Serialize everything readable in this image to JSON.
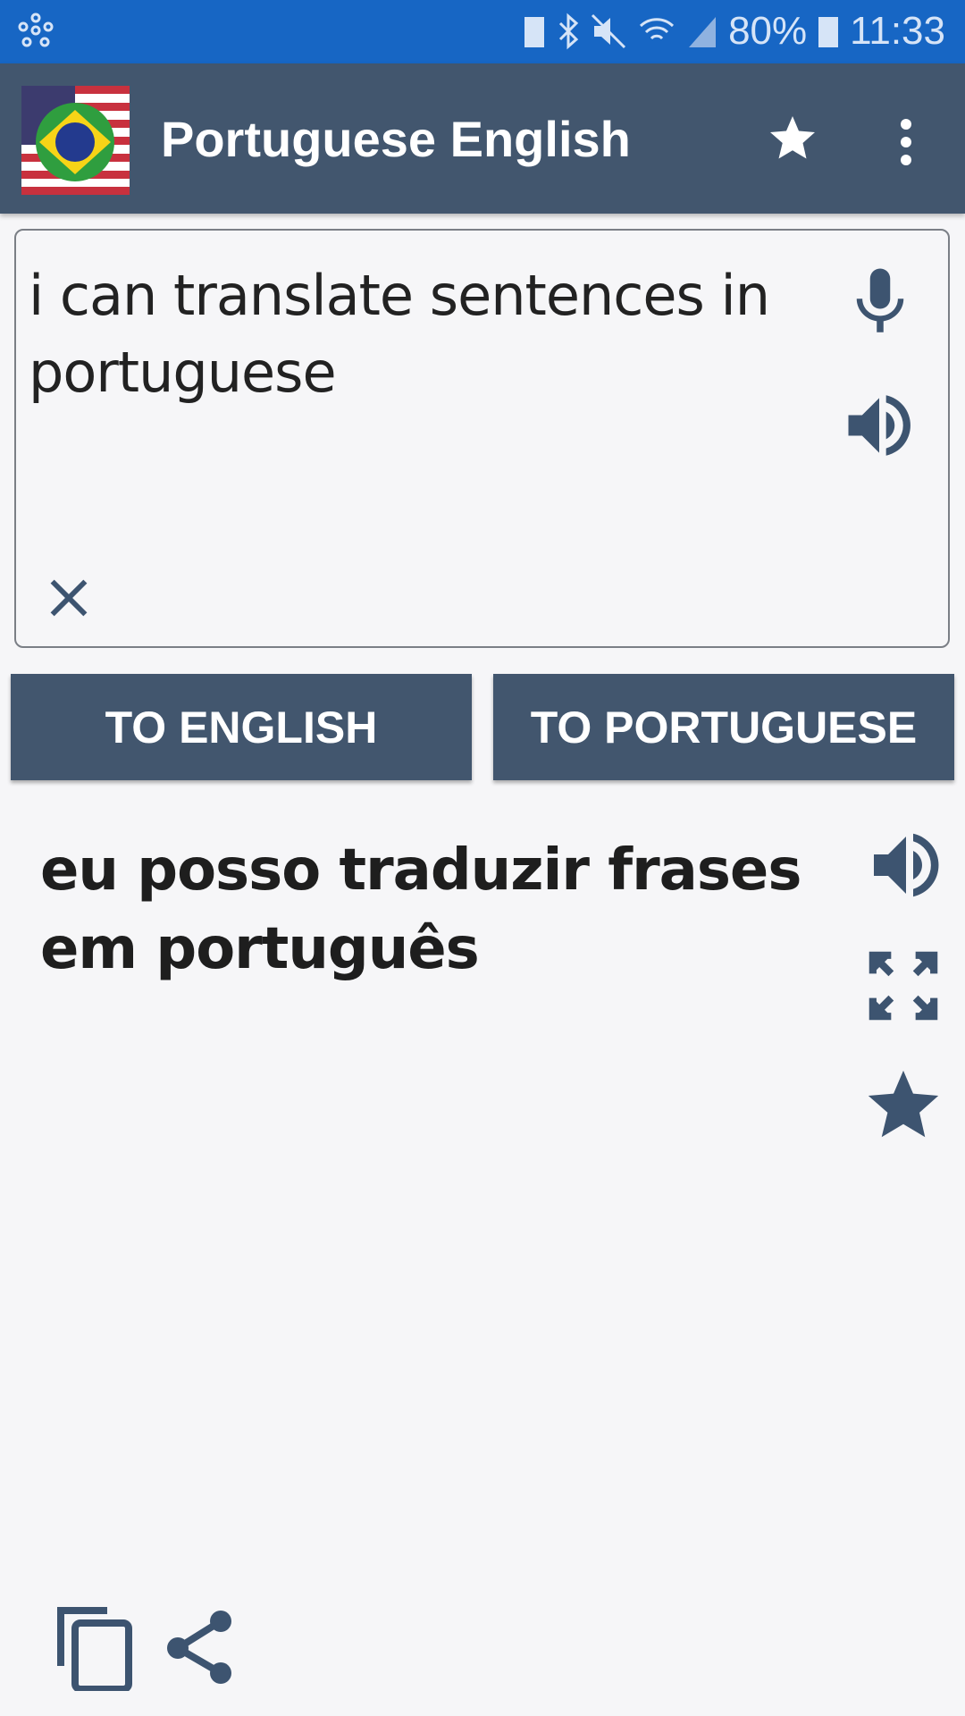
{
  "status_bar": {
    "battery": "80%",
    "time": "11:33",
    "icons": [
      "network-hub-icon",
      "battery-saver-icon",
      "bluetooth-icon",
      "mute-icon",
      "wifi-icon",
      "signal-icon",
      "charging-battery-icon"
    ]
  },
  "app_bar": {
    "title": "Portuguese English",
    "icons": [
      "flag-logo",
      "star-icon",
      "more-vert-icon"
    ]
  },
  "input": {
    "value": "i can translate sentences in portuguese"
  },
  "buttons": {
    "to_english": "TO ENGLISH",
    "to_portuguese": "TO PORTUGUESE"
  },
  "output": {
    "text": "eu posso traduzir frases em português"
  },
  "colors": {
    "status_bar": "#1766c4",
    "app_bar": "#42566e",
    "icon": "#3d5470",
    "background": "#f6f6f8"
  }
}
